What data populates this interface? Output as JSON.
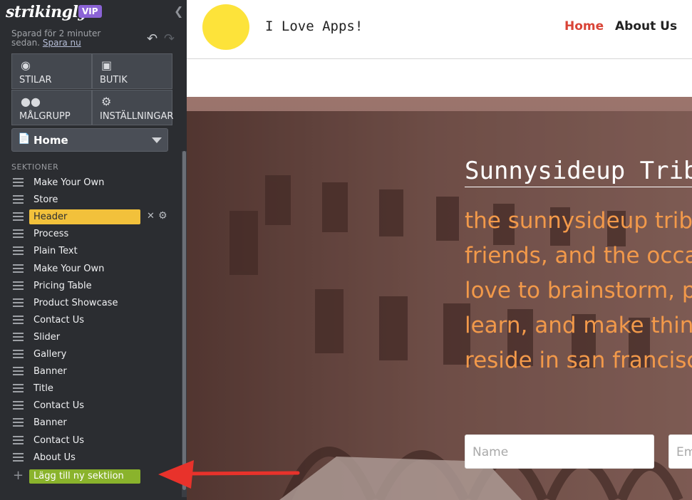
{
  "sidebar": {
    "brand": "strikingly",
    "vip": "VIP",
    "saved_text": "Sparad för 2 minuter sedan.",
    "saved_link": "Spara nu",
    "tiles": [
      {
        "label": "STILAR",
        "icon": "palette-icon"
      },
      {
        "label": "BUTIK",
        "icon": "shopping-bag-icon"
      },
      {
        "label": "MÅLGRUPP",
        "icon": "people-icon"
      },
      {
        "label": "INSTÄLLNINGAR",
        "icon": "gear-icon"
      }
    ],
    "page_select": "Home",
    "sections_heading": "SEKTIONER",
    "sections": [
      "Make Your Own",
      "Store",
      "Header",
      "Process",
      "Plain Text",
      "Make Your Own",
      "Pricing Table",
      "Product Showcase",
      "Contact Us",
      "Slider",
      "Gallery",
      "Banner",
      "Title",
      "Contact Us",
      "Banner",
      "Contact Us",
      "About Us"
    ],
    "active_section": "Header",
    "add_section": "Lägg till ny sektiion"
  },
  "site": {
    "title": "I Love Apps!",
    "nav": {
      "home": "Home",
      "about": "About Us"
    },
    "hero_title": "Sunnysideup Tribe",
    "hero_text": "the sunnysideup tribe is a group of\nfriends, and the occasional guest, who\nlove to brainstorm, play, explore,\nlearn, and make things. we mostly\nreside in san francisco.",
    "name_placeholder": "Name",
    "email_placeholder": "Email"
  },
  "colors": {
    "sidebar_bg": "#2b2d31",
    "active_section": "#f2c13b",
    "add_button": "#8ab32c",
    "nav_active": "#d94437",
    "hero_text": "#f2994a",
    "arrow": "#e8322b"
  }
}
